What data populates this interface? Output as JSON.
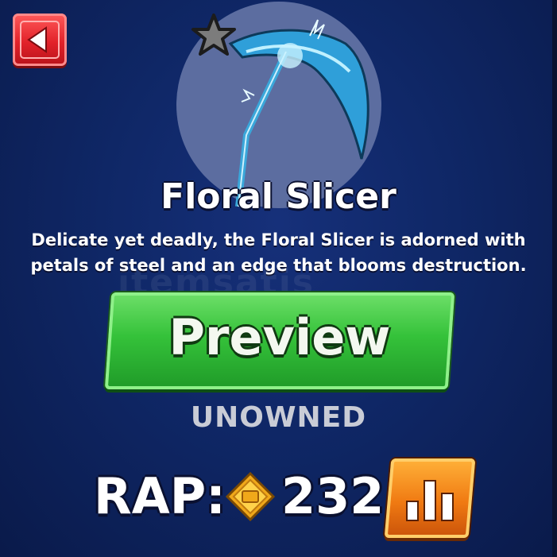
{
  "item": {
    "name": "Floral Slicer",
    "description": "Delicate yet deadly, the Floral Slicer is adorned with petals of steel and an edge that blooms destruction."
  },
  "watermark": "itemsatis",
  "buttons": {
    "preview_label": "Preview"
  },
  "status": "UNOWNED",
  "rap": {
    "label": "RAP:",
    "value": "232"
  },
  "icons": {
    "back": "back-arrow-icon",
    "favorite": "star-icon",
    "currency": "coin-icon",
    "stats": "bar-chart-icon"
  },
  "colors": {
    "background": "#0f2766",
    "preview_button": "#35c23a",
    "back_button": "#e2222a",
    "stats_button": "#f07a12",
    "status_text": "#c9ccd6"
  }
}
